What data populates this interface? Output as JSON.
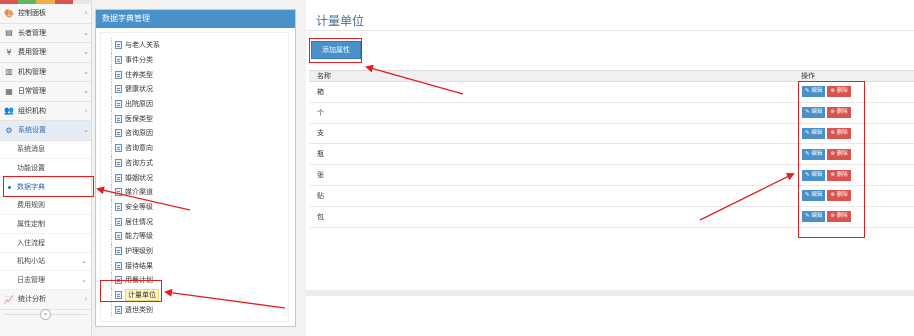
{
  "sidebar": {
    "strip_colors": [
      "#d9534f",
      "#5cb85c",
      "#f0ad4e",
      "#d9534f",
      "#e8e8e8"
    ],
    "items": [
      {
        "icon": "🎨",
        "icon_name": "dashboard-icon",
        "label": "控制面板",
        "chevron": "›"
      },
      {
        "icon": "▤",
        "icon_name": "elder-icon",
        "label": "长者管理",
        "chevron": "⌄"
      },
      {
        "icon": "¥",
        "icon_name": "yen-icon",
        "label": "费用管理",
        "chevron": "⌄"
      },
      {
        "icon": "▥",
        "icon_name": "institution-icon",
        "label": "机构管理",
        "chevron": "⌄"
      },
      {
        "icon": "▦",
        "icon_name": "daily-icon",
        "label": "日常管理",
        "chevron": "⌄"
      },
      {
        "icon": "👥",
        "icon_name": "group-icon",
        "label": "组织机构",
        "chevron": "›"
      },
      {
        "icon": "⚙",
        "icon_name": "settings-icon",
        "label": "系统设置",
        "chevron": "⌄"
      }
    ],
    "sub_items": [
      {
        "label": "系统消息"
      },
      {
        "label": "功能设置"
      },
      {
        "label": "数据字典"
      },
      {
        "label": "费用规则"
      },
      {
        "label": "属性定制"
      },
      {
        "label": "入住流程"
      },
      {
        "label": "机构小站",
        "chevron": "⌄"
      },
      {
        "label": "日志管理",
        "chevron": "⌄"
      }
    ],
    "bottom_item": {
      "icon": "📈",
      "icon_name": "stats-icon",
      "label": "统计分析",
      "chevron": "›"
    },
    "collapse_glyph": "«"
  },
  "tree_panel": {
    "title": "数据字典管理",
    "nodes": [
      "与老人关系",
      "事件分类",
      "住养类型",
      "健康状况",
      "出院原因",
      "医保类型",
      "咨询原因",
      "咨询意向",
      "咨询方式",
      "婚姻状况",
      "媒介渠道",
      "安全等级",
      "居住情况",
      "能力等级",
      "护理级别",
      "接待结果",
      "用餐计划",
      "计量单位",
      "遗世类别"
    ],
    "selected": "计量单位"
  },
  "main": {
    "title": "计量单位",
    "add_button": "添加属性",
    "columns": {
      "name": "名称",
      "op": "操作"
    },
    "edit_label": "✎ 编辑",
    "delete_label": "⊗ 删除",
    "rows": [
      "箱",
      "个",
      "支",
      "瓶",
      "张",
      "贴",
      "包"
    ]
  },
  "colors": {
    "accent": "#4a90c9",
    "danger": "#d9534f",
    "annotation": "#e02020"
  }
}
